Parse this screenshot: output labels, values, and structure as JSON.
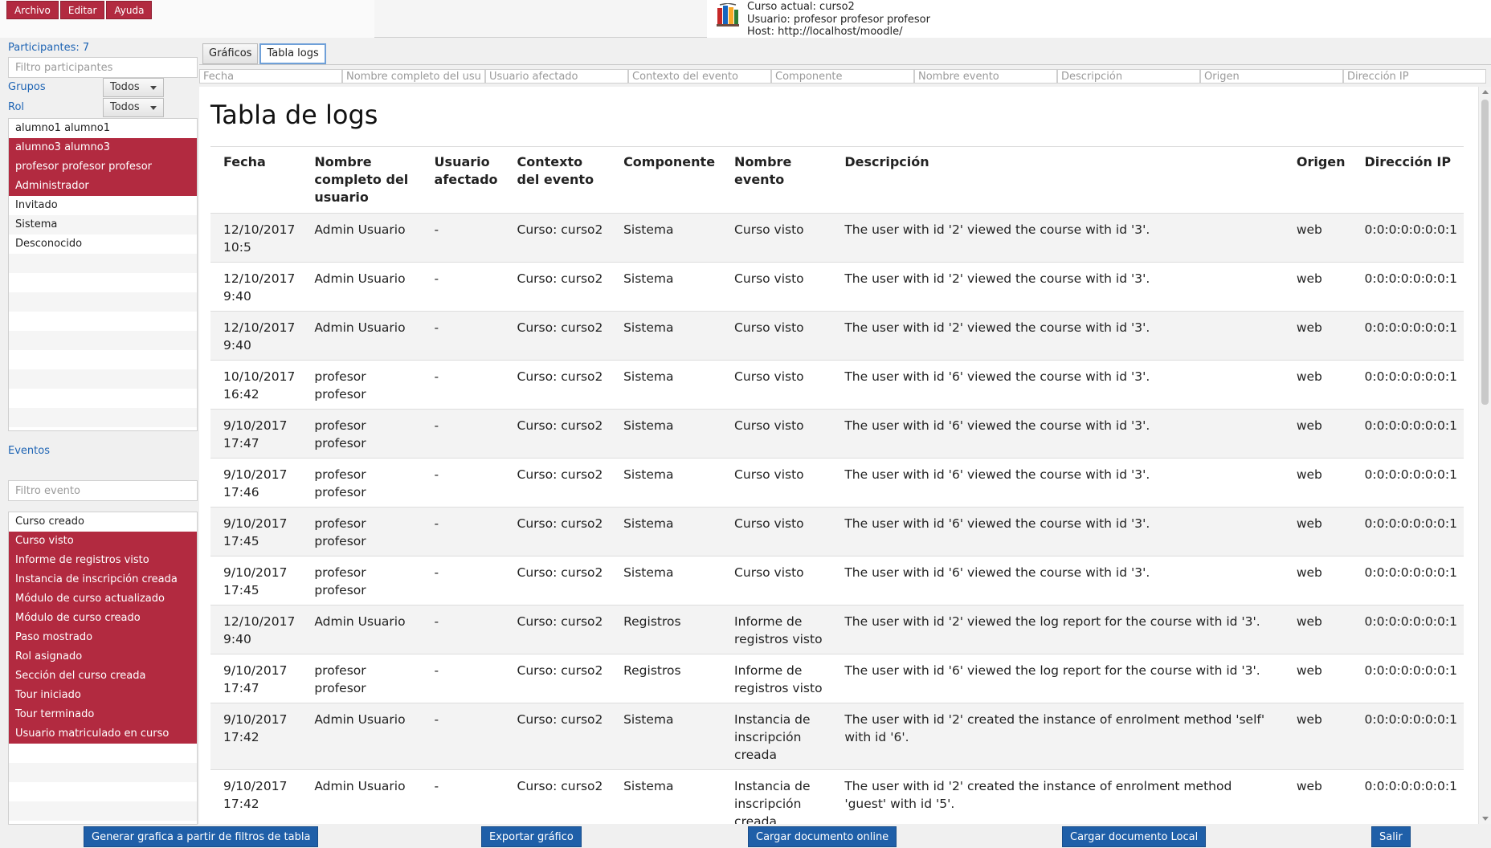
{
  "menu": {
    "file": "Archivo",
    "edit": "Editar",
    "help": "Ayuda"
  },
  "course_info": {
    "course": "Curso actual: curso2",
    "user": "Usuario: profesor profesor profesor",
    "host": "Host: http://localhost/moodle/"
  },
  "sidebar": {
    "participants_label": "Participantes: 7",
    "participants_filter_placeholder": "Filtro participantes",
    "groups_label": "Grupos",
    "groups_value": "Todos",
    "role_label": "Rol",
    "role_value": "Todos",
    "users": [
      {
        "name": "alumno1 alumno1",
        "selected": false
      },
      {
        "name": "alumno3 alumno3",
        "selected": true
      },
      {
        "name": "profesor profesor profesor",
        "selected": true
      },
      {
        "name": "Administrador",
        "selected": true
      },
      {
        "name": "Invitado",
        "selected": false
      },
      {
        "name": "Sistema",
        "selected": false
      },
      {
        "name": "Desconocido",
        "selected": false
      }
    ],
    "events_label": "Eventos",
    "events_filter_placeholder": "Filtro evento",
    "events": [
      {
        "name": "Curso creado",
        "selected": false
      },
      {
        "name": "Curso visto",
        "selected": true
      },
      {
        "name": "Informe de registros visto",
        "selected": true
      },
      {
        "name": "Instancia de inscripción creada",
        "selected": true
      },
      {
        "name": "Módulo de curso actualizado",
        "selected": true
      },
      {
        "name": "Módulo de curso creado",
        "selected": true
      },
      {
        "name": "Paso mostrado",
        "selected": true
      },
      {
        "name": "Rol asignado",
        "selected": true
      },
      {
        "name": "Sección del curso creada",
        "selected": true
      },
      {
        "name": "Tour iniciado",
        "selected": true
      },
      {
        "name": "Tour terminado",
        "selected": true
      },
      {
        "name": "Usuario matriculado en curso",
        "selected": true
      }
    ]
  },
  "tabs": [
    {
      "label": "Gráficos",
      "active": false
    },
    {
      "label": "Tabla logs",
      "active": true
    }
  ],
  "column_filters": [
    "Fecha",
    "Nombre completo del usu",
    "Usuario afectado",
    "Contexto del evento",
    "Componente",
    "Nombre evento",
    "Descripción",
    "Origen",
    "Dirección IP"
  ],
  "page_title": "Tabla de logs",
  "table": {
    "headers": [
      "Fecha",
      "Nombre completo del usuario",
      "Usuario afectado",
      "Contexto del evento",
      "Componente",
      "Nombre evento",
      "Descripción",
      "Origen",
      "Dirección IP"
    ],
    "rows": [
      [
        "12/10/2017 10:5",
        "Admin Usuario",
        "-",
        "Curso: curso2",
        "Sistema",
        "Curso visto",
        "The user with id '2' viewed the course with id '3'.",
        "web",
        "0:0:0:0:0:0:0:1"
      ],
      [
        "12/10/2017 9:40",
        "Admin Usuario",
        "-",
        "Curso: curso2",
        "Sistema",
        "Curso visto",
        "The user with id '2' viewed the course with id '3'.",
        "web",
        "0:0:0:0:0:0:0:1"
      ],
      [
        "12/10/2017 9:40",
        "Admin Usuario",
        "-",
        "Curso: curso2",
        "Sistema",
        "Curso visto",
        "The user with id '2' viewed the course with id '3'.",
        "web",
        "0:0:0:0:0:0:0:1"
      ],
      [
        "10/10/2017 16:42",
        "profesor profesor",
        "-",
        "Curso: curso2",
        "Sistema",
        "Curso visto",
        "The user with id '6' viewed the course with id '3'.",
        "web",
        "0:0:0:0:0:0:0:1"
      ],
      [
        "9/10/2017 17:47",
        "profesor profesor",
        "-",
        "Curso: curso2",
        "Sistema",
        "Curso visto",
        "The user with id '6' viewed the course with id '3'.",
        "web",
        "0:0:0:0:0:0:0:1"
      ],
      [
        "9/10/2017 17:46",
        "profesor profesor",
        "-",
        "Curso: curso2",
        "Sistema",
        "Curso visto",
        "The user with id '6' viewed the course with id '3'.",
        "web",
        "0:0:0:0:0:0:0:1"
      ],
      [
        "9/10/2017 17:45",
        "profesor profesor",
        "-",
        "Curso: curso2",
        "Sistema",
        "Curso visto",
        "The user with id '6' viewed the course with id '3'.",
        "web",
        "0:0:0:0:0:0:0:1"
      ],
      [
        "9/10/2017 17:45",
        "profesor profesor",
        "-",
        "Curso: curso2",
        "Sistema",
        "Curso visto",
        "The user with id '6' viewed the course with id '3'.",
        "web",
        "0:0:0:0:0:0:0:1"
      ],
      [
        "12/10/2017 9:40",
        "Admin Usuario",
        "-",
        "Curso: curso2",
        "Registros",
        "Informe de registros visto",
        "The user with id '2' viewed the log report for the course with id '3'.",
        "web",
        "0:0:0:0:0:0:0:1"
      ],
      [
        "9/10/2017 17:47",
        "profesor profesor",
        "-",
        "Curso: curso2",
        "Registros",
        "Informe de registros visto",
        "The user with id '6' viewed the log report for the course with id '3'.",
        "web",
        "0:0:0:0:0:0:0:1"
      ],
      [
        "9/10/2017 17:42",
        "Admin Usuario",
        "-",
        "Curso: curso2",
        "Sistema",
        "Instancia de inscripción creada",
        "The user with id '2' created the instance of enrolment method 'self' with id '6'.",
        "web",
        "0:0:0:0:0:0:0:1"
      ],
      [
        "9/10/2017 17:42",
        "Admin Usuario",
        "-",
        "Curso: curso2",
        "Sistema",
        "Instancia de inscripción creada",
        "The user with id '2' created the instance of enrolment method 'guest' with id '5'.",
        "web",
        "0:0:0:0:0:0:0:1"
      ]
    ]
  },
  "buttons": {
    "generate_chart": "Generar grafica a partir de filtros de tabla",
    "export_chart": "Exportar gráfico",
    "load_online": "Cargar documento online",
    "load_local": "Cargar documento Local",
    "exit": "Salir"
  },
  "colors": {
    "accent": "#b22a40",
    "button": "#1f5fa8",
    "link": "#1e64b4"
  },
  "icons": {
    "app_logo": "books-logo-icon"
  }
}
